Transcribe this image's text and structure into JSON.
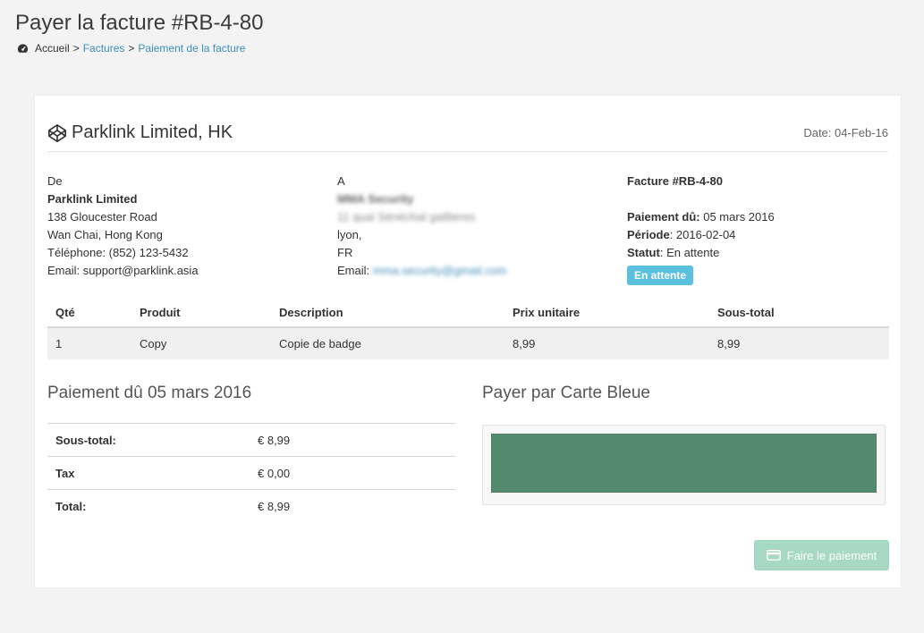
{
  "page": {
    "title": "Payer la facture #RB-4-80",
    "breadcrumb": {
      "home": "Accueil",
      "sep1": ">",
      "invoices": "Factures",
      "sep2": ">",
      "current": "Paiement de la facture"
    }
  },
  "invoice": {
    "brand": "Parklink Limited, HK",
    "date": "Date: 04-Feb-16",
    "from": {
      "label": "De",
      "company": "Parklink Limited",
      "address1": "138 Gloucester Road",
      "address2": "Wan Chai, Hong Kong",
      "phone": "Téléphone: (852) 123-5432",
      "email": "Email: support@parklink.asia"
    },
    "to": {
      "label": "A",
      "company": "MMA Security",
      "address": "11 quai Sénéchal gaillieres",
      "city": "lyon,",
      "country": "FR",
      "email_label": "Email:",
      "email": "mma.security@gmail.com"
    },
    "meta": {
      "number": "Facture #RB-4-80",
      "due_label": "Paiement dû:",
      "due_value": " 05 mars 2016",
      "period_label": "Période",
      "period_value": ": 2016-02-04",
      "status_label": "Statut",
      "status_value": ": En attente",
      "badge": "En attente"
    },
    "table": {
      "headers": [
        "Qté",
        "Produit",
        "Description",
        "Prix unitaire",
        "Sous-total"
      ],
      "rows": [
        [
          "1",
          "Copy",
          "Copie de badge",
          "8,99",
          "8,99"
        ]
      ]
    },
    "due_title": "Paiement dû 05 mars 2016",
    "totals": [
      {
        "label": "Sous-total:",
        "value": "€ 8,99"
      },
      {
        "label": "Tax",
        "value": "€ 0,00"
      },
      {
        "label": "Total:",
        "value": "€ 8,99"
      }
    ],
    "pay_title": "Payer par Carte Bleue",
    "pay_button": "Faire le paiement"
  },
  "colors": {
    "link": "#3c8dbc",
    "badge": "#5bc0de",
    "card_frame": "#548a6e",
    "pay_button": "#a7d9c4"
  },
  "icons": {
    "breadcrumb": "dashboard-icon",
    "brand": "codepen-icon",
    "pay_button": "credit-card-icon"
  }
}
